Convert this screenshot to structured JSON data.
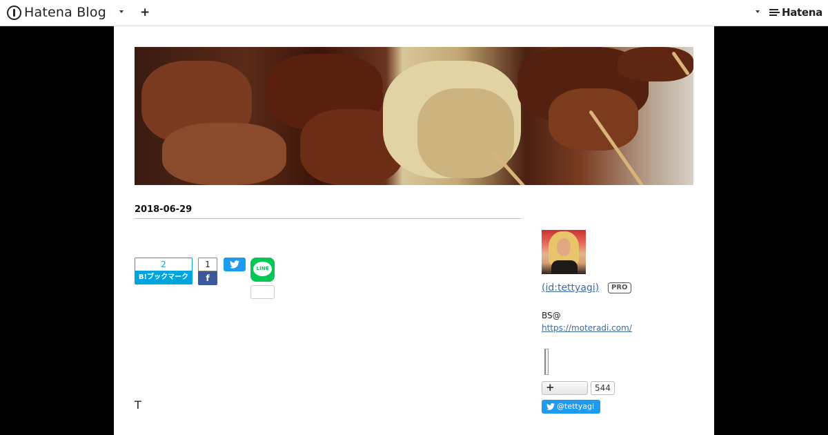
{
  "topbar": {
    "brand": "Hatena Blog",
    "add_label": "+",
    "hatena_label": "Hatena"
  },
  "article": {
    "date": "2018-06-29",
    "hatena_bookmark": {
      "count": "2",
      "label": "B!ブックマーク"
    },
    "facebook": {
      "count": "1",
      "label": "f"
    },
    "line_label": "LINE",
    "body_start": "T"
  },
  "sidebar": {
    "user_link": " (id:tettyagi)",
    "pro_badge": "PRO",
    "description": "BS@",
    "site_url": "https://moteradi.com/",
    "followers": "544",
    "twitter_handle": "@tettyagi"
  },
  "colors": {
    "hatena_bookmark": "#00a4de",
    "facebook": "#3b5998",
    "twitter": "#1d9bf0",
    "line": "#06c755",
    "link": "#3d6b9e"
  }
}
